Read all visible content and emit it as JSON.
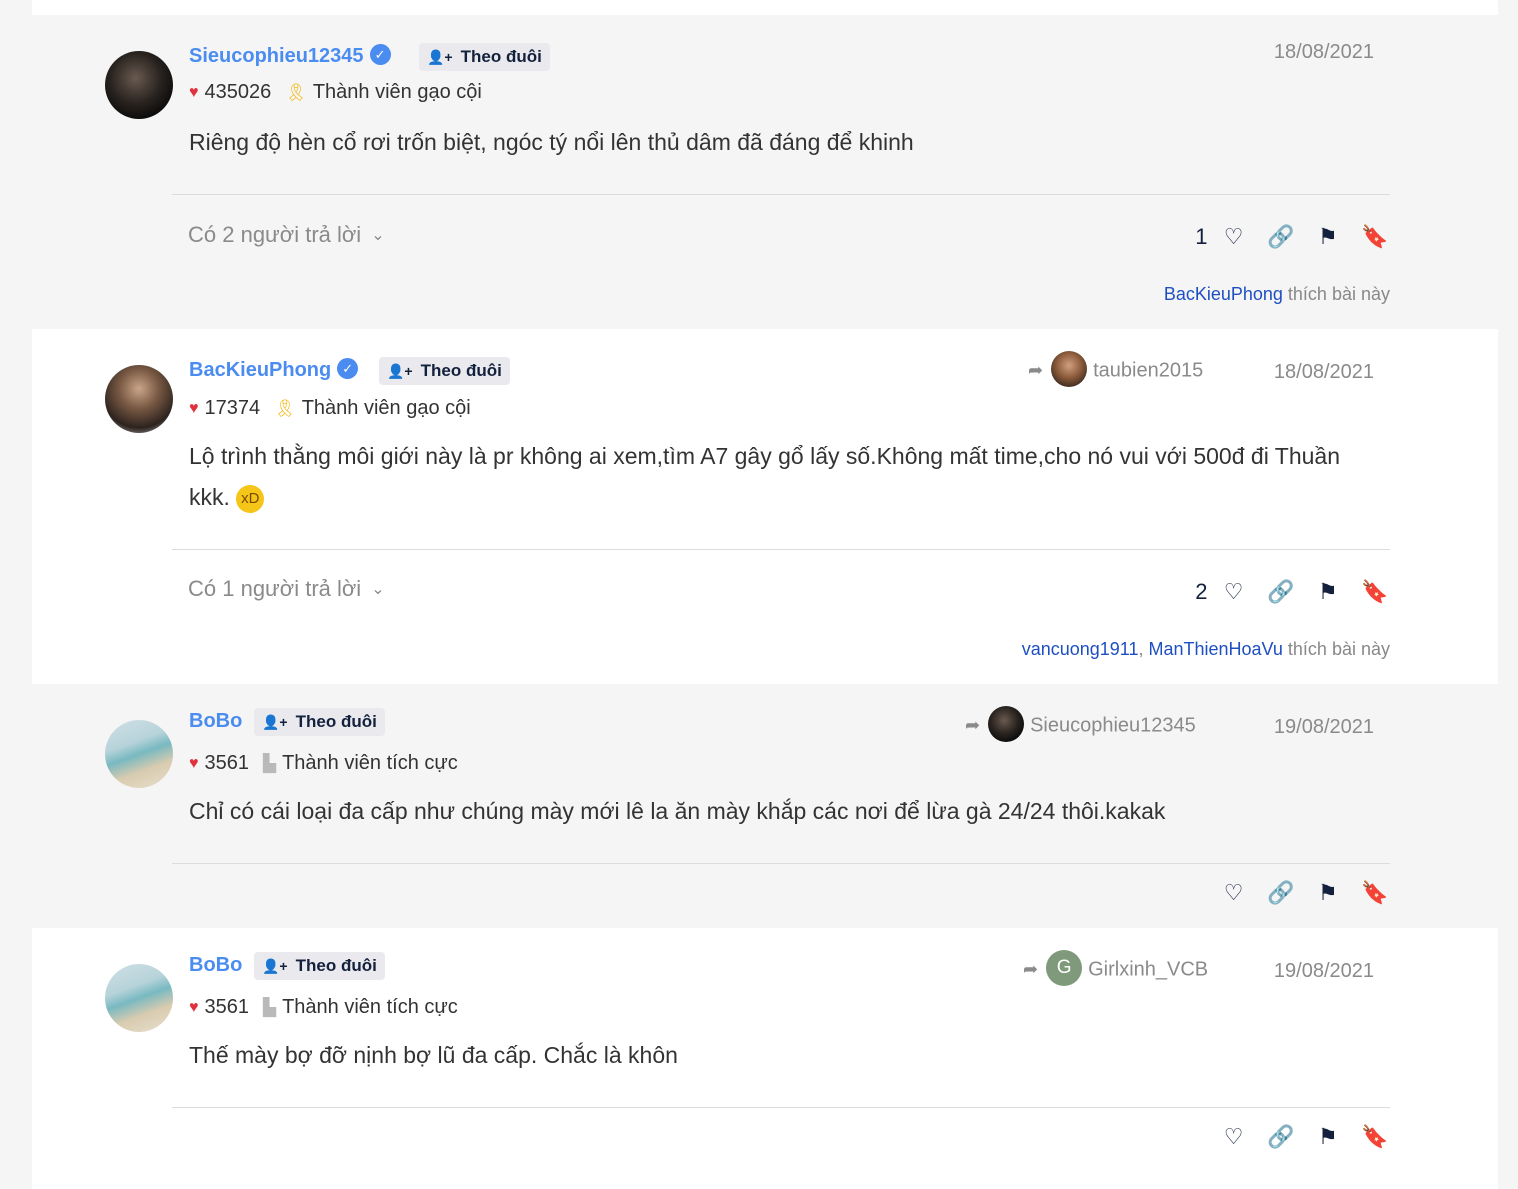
{
  "posts": [
    {
      "username": "Sieucophieu12345",
      "verified": true,
      "follow_label": "Theo đuôi",
      "points": "435026",
      "rank": "Thành viên gạo cội",
      "date": "18/08/2021",
      "reply_to": "",
      "content": "Riêng độ hèn cổ rơi trốn biệt, ngóc tý nổi lên thủ dâm đã đáng để khinh",
      "replies": "Có 2 người trả lời",
      "like_count": "1",
      "likers": [
        "BacKieuPhong"
      ],
      "likes_suffix": "thích bài này"
    },
    {
      "username": "BacKieuPhong",
      "verified": true,
      "follow_label": "Theo đuôi",
      "points": "17374",
      "rank": "Thành viên gạo cội",
      "date": "18/08/2021",
      "reply_to": "taubien2015",
      "content": "Lộ trình thằng môi giới này là pr không ai xem,tìm A7 gây gổ lấy số.Không mất time,cho nó vui với 500đ đi Thuần kkk.",
      "replies": "Có 1 người trả lời",
      "like_count": "2",
      "likers": [
        "vancuong1911",
        "ManThienHoaVu"
      ],
      "likes_suffix": "thích bài này"
    },
    {
      "username": "BoBo",
      "verified": false,
      "follow_label": "Theo đuôi",
      "points": "3561",
      "rank": "Thành viên tích cực",
      "date": "19/08/2021",
      "reply_to": "Sieucophieu12345",
      "content": "Chỉ có cái loại đa cấp như chúng mày mới lê la ăn mày khắp các nơi để lừa gà 24/24 thôi.kakak"
    },
    {
      "username": "BoBo",
      "verified": false,
      "follow_label": "Theo đuôi",
      "points": "3561",
      "rank": "Thành viên tích cực",
      "date": "19/08/2021",
      "reply_to": "Girlxinh_VCB",
      "reply_to_initial": "G",
      "content": "Thế mày bợ đỡ nịnh bợ lũ đa cấp. Chắc là khôn"
    }
  ],
  "icons": {
    "heart": "heart-outline-icon",
    "link": "link-icon",
    "flag": "flag-icon",
    "bookmark": "bookmark-icon",
    "reply": "reply-arrow-icon",
    "follow": "user-plus-icon",
    "verified": "verified-check-icon"
  },
  "colors": {
    "username": "#4a8cf0",
    "action": "#14213d",
    "heart": "#e0323c",
    "liker_link": "#1e4fc2"
  }
}
